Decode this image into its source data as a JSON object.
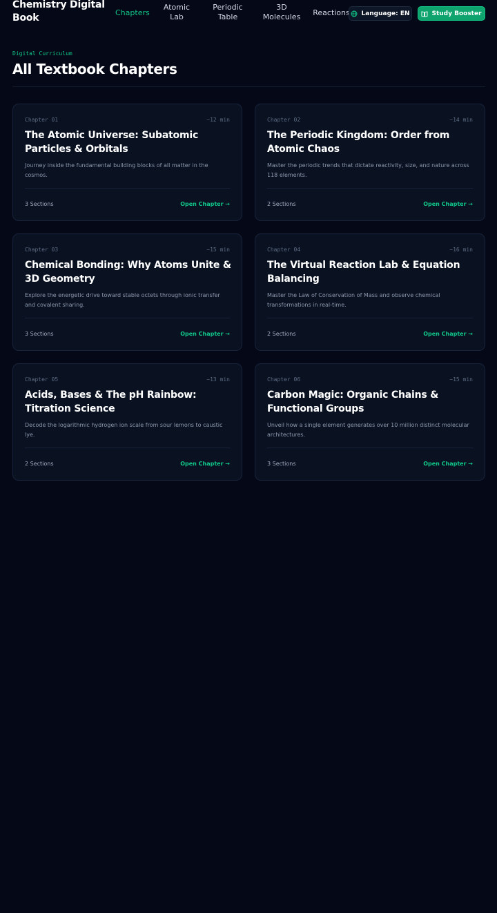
{
  "header": {
    "brand": "Chemistry Digital Book",
    "nav": [
      {
        "label": "Chapters",
        "active": true
      },
      {
        "label": "Atomic Lab",
        "active": false
      },
      {
        "label": "Periodic Table",
        "active": false
      },
      {
        "label": "3D Molecules",
        "active": false
      },
      {
        "label": "Reactions",
        "active": false
      }
    ],
    "language_label": "Language: EN",
    "language_icon": "globe-icon",
    "study_label": "Study Booster",
    "study_icon": "book-icon"
  },
  "hero": {
    "eyebrow": "Digital Curriculum",
    "title": "All Textbook Chapters"
  },
  "chapters": [
    {
      "number": "Chapter 01",
      "duration": "~12 min",
      "title": "The Atomic Universe: Subatomic Particles & Orbitals",
      "description": "Journey inside the fundamental building blocks of all matter in the cosmos.",
      "sections": "3 Sections",
      "link": "Open Chapter →"
    },
    {
      "number": "Chapter 02",
      "duration": "~14 min",
      "title": "The Periodic Kingdom: Order from Atomic Chaos",
      "description": "Master the periodic trends that dictate reactivity, size, and nature across 118 elements.",
      "sections": "2 Sections",
      "link": "Open Chapter →"
    },
    {
      "number": "Chapter 03",
      "duration": "~15 min",
      "title": "Chemical Bonding: Why Atoms Unite & 3D Geometry",
      "description": "Explore the energetic drive toward stable octets through ionic transfer and covalent sharing.",
      "sections": "3 Sections",
      "link": "Open Chapter →"
    },
    {
      "number": "Chapter 04",
      "duration": "~16 min",
      "title": "The Virtual Reaction Lab & Equation Balancing",
      "description": "Master the Law of Conservation of Mass and observe chemical transformations in real-time.",
      "sections": "2 Sections",
      "link": "Open Chapter →"
    },
    {
      "number": "Chapter 05",
      "duration": "~13 min",
      "title": "Acids, Bases & The pH Rainbow: Titration Science",
      "description": "Decode the logarithmic hydrogen ion scale from sour lemons to caustic lye.",
      "sections": "2 Sections",
      "link": "Open Chapter →"
    },
    {
      "number": "Chapter 06",
      "duration": "~15 min",
      "title": "Carbon Magic: Organic Chains & Functional Groups",
      "description": "Unveil how a single element generates over 10 million distinct molecular architectures.",
      "sections": "3 Sections",
      "link": "Open Chapter →"
    }
  ],
  "colors": {
    "background": "#050816",
    "accent": "#10c98a",
    "card": "#0a1222"
  }
}
